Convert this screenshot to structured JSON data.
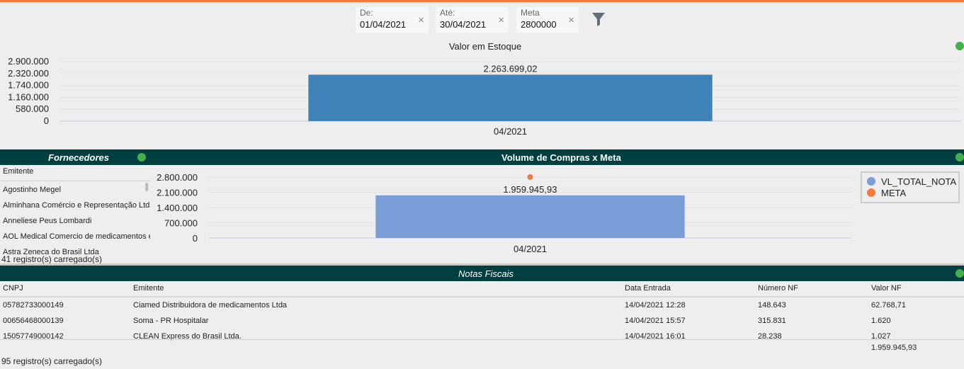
{
  "filters": {
    "de": {
      "label": "De:",
      "value": "01/04/2021"
    },
    "ate": {
      "label": "Até:",
      "value": "30/04/2021"
    },
    "meta": {
      "label": "Meta",
      "value": "2800000"
    },
    "clear_glyph": "×"
  },
  "colors": {
    "accent_orange": "#f47a3c",
    "header_band": "#003f3f",
    "status_green": "#44b04b",
    "bar_estoque": "#3e82b7",
    "bar_compras": "#7b9dd8",
    "meta_point": "#f47a3c"
  },
  "icons": {
    "filter": "funnel-icon",
    "clear": "close-icon",
    "status": "green-dot-icon"
  },
  "estoque": {
    "title": "Valor em Estoque",
    "chart_data": {
      "type": "bar",
      "categories": [
        "04/2021"
      ],
      "values": [
        2263699.02
      ],
      "data_labels": [
        "2.263.699,02"
      ],
      "ytick_labels": [
        "2.900.000",
        "2.320.000",
        "1.740.000",
        "1.160.000",
        "580.000",
        "0"
      ],
      "yticks": [
        2900000,
        2320000,
        1740000,
        1160000,
        580000,
        0
      ],
      "ylim": [
        0,
        2900000
      ],
      "color": "#3e82b7"
    }
  },
  "fornecedores": {
    "title": "Fornecedores",
    "column_header": "Emitente",
    "rows": [
      "Agostinho Megel",
      "Alminhana Comércio e Representação Ltda",
      "Anneliese Peus Lombardi",
      "AOL Medical Comercio de medicamentos e",
      "Astra Zeneca do Brasil Ltda"
    ],
    "status": "41 registro(s) carregado(s)"
  },
  "compras": {
    "title": "Volume de Compras x Meta",
    "chart_data": {
      "type": "bar",
      "categories": [
        "04/2021"
      ],
      "series": [
        {
          "name": "VL_TOTAL_NOTA",
          "values": [
            1959945.93
          ],
          "color": "#7b9dd8"
        },
        {
          "name": "META",
          "values": [
            2800000
          ],
          "color": "#f47a3c"
        }
      ],
      "data_labels": [
        "1.959.945,93"
      ],
      "ytick_labels": [
        "2.800.000",
        "2.100.000",
        "1.400.000",
        "700.000",
        "0"
      ],
      "yticks": [
        2800000,
        2100000,
        1400000,
        700000,
        0
      ],
      "ylim": [
        0,
        2800000
      ],
      "legend_position": "right"
    }
  },
  "notas": {
    "title": "Notas Fiscais",
    "columns": [
      "CNPJ",
      "Emitente",
      "Data Entrada",
      "Número NF",
      "Valor NF"
    ],
    "rows": [
      [
        "05782733000149",
        "Ciamed Distribuidora de medicamentos Ltda",
        "14/04/2021 12:28",
        "148.643",
        "62.768,71"
      ],
      [
        "00656468000139",
        "Soma - PR Hospitalar",
        "14/04/2021 15:57",
        "315.831",
        "1.620"
      ],
      [
        "15057749000142",
        "CLEAN Express do Brasil Ltda.",
        "14/04/2021 16:01",
        "28.238",
        "1.027"
      ]
    ],
    "total": "1.959.945,93",
    "status": "95 registro(s) carregado(s)"
  }
}
